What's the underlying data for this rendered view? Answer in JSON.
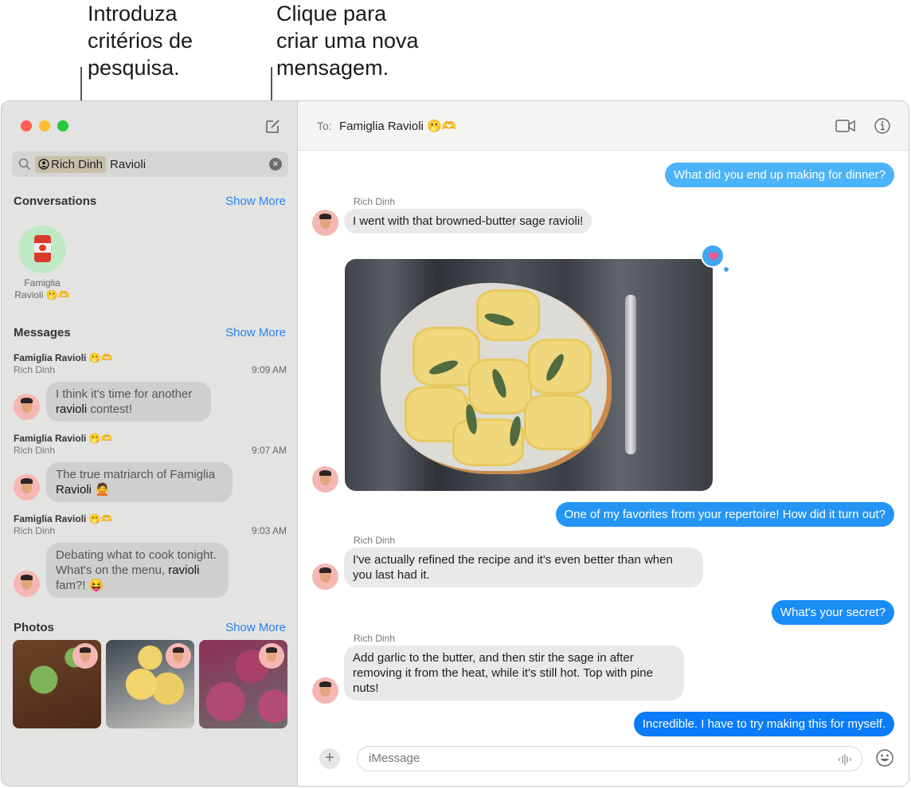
{
  "callouts": {
    "search": [
      "Introduza",
      "critérios de",
      "pesquisa."
    ],
    "compose": [
      "Clique para",
      "criar uma nova",
      "mensagem."
    ]
  },
  "sidebar": {
    "search": {
      "token": "Rich Dinh",
      "text": "Ravioli",
      "clear_icon": "×"
    },
    "conversations": {
      "title": "Conversations",
      "show_more": "Show More",
      "items": [
        {
          "name_line1": "Famiglia",
          "name_line2": "Ravioli 🫢🫶"
        }
      ]
    },
    "messages": {
      "title": "Messages",
      "show_more": "Show More",
      "items": [
        {
          "title": "Famiglia Ravioli 🫢🫶",
          "sender": "Rich Dinh",
          "time": "9:09 AM",
          "pre": "I think it's time for another",
          "highlight": "ravioli",
          "post": " contest!"
        },
        {
          "title": "Famiglia Ravioli 🫢🫶",
          "sender": "Rich Dinh",
          "time": "9:07 AM",
          "pre": "The true matriarch of Famiglia",
          "highlight": "Ravioli",
          "post": " 🙅"
        },
        {
          "title": "Famiglia Ravioli 🫢🫶",
          "sender": "Rich Dinh",
          "time": "9:03 AM",
          "pre": "Debating what to cook tonight. What's on the menu,",
          "highlight": "ravioli",
          "post": " fam?! 😝"
        }
      ]
    },
    "photos": {
      "title": "Photos",
      "show_more": "Show More",
      "items": [
        "green-ravioli-photo",
        "sage-ravioli-photo",
        "beet-ravioli-photo"
      ]
    }
  },
  "conversation": {
    "to_label": "To:",
    "to_value": "Famiglia Ravioli 🫢🫶",
    "messages": [
      {
        "direction": "out",
        "text": "What did you end up making for dinner?",
        "color": "#4bb3f7"
      },
      {
        "direction": "in",
        "sender": "Rich Dinh",
        "text": "I went with that browned-butter sage ravioli!"
      },
      {
        "direction": "in",
        "type": "photo",
        "reaction": "heart"
      },
      {
        "direction": "out",
        "text": "One of my favorites from your repertoire! How did it turn out?",
        "color": "#2595f4"
      },
      {
        "direction": "in",
        "sender": "Rich Dinh",
        "text": "I've actually refined the recipe and it's even better than when you last had it."
      },
      {
        "direction": "out",
        "text": "What's your secret?",
        "color": "#1a8cf6"
      },
      {
        "direction": "in",
        "sender": "Rich Dinh",
        "text": "Add garlic to the butter, and then stir the sage in after removing it from the heat, while it's still hot. Top with pine nuts!"
      },
      {
        "direction": "out",
        "text": "Incredible. I have to try making this for myself.",
        "color": "#0a7cf8"
      }
    ],
    "composer": {
      "placeholder": "iMessage",
      "plus": "+"
    }
  }
}
